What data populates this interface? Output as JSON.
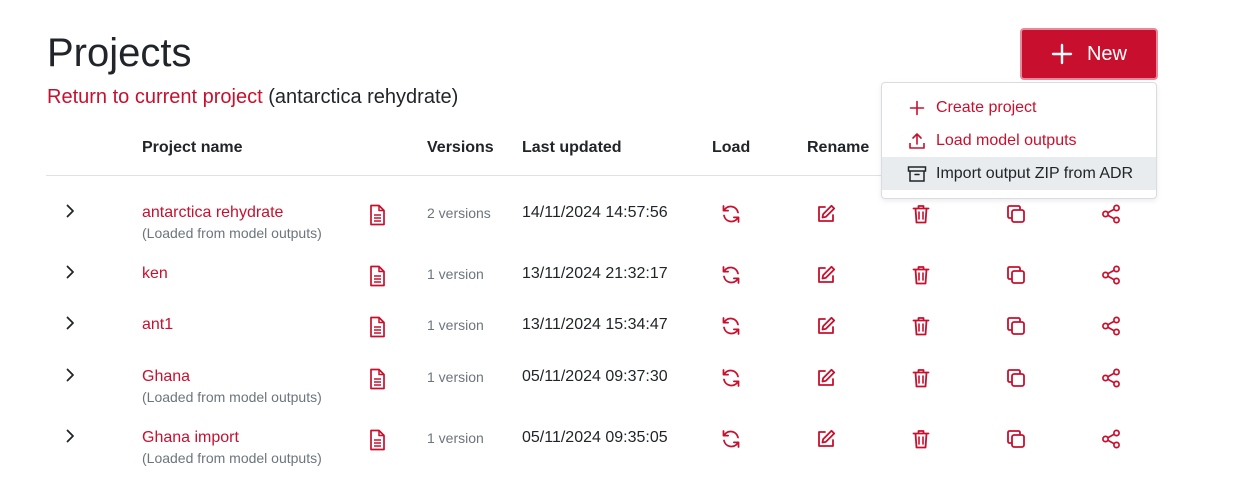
{
  "page": {
    "title": "Projects"
  },
  "return_link": {
    "label": "Return to current project",
    "current": "(antarctica rehydrate)"
  },
  "new_button": {
    "label": "New"
  },
  "new_menu": {
    "items": [
      {
        "label": "Create project",
        "icon": "plus-icon"
      },
      {
        "label": "Load model outputs",
        "icon": "upload-icon"
      },
      {
        "label": "Import output ZIP from ADR",
        "icon": "archive-icon"
      }
    ]
  },
  "table": {
    "headers": {
      "project_name": "Project name",
      "versions": "Versions",
      "last_updated": "Last updated",
      "load": "Load",
      "rename": "Rename"
    },
    "rows": [
      {
        "name": "antarctica rehydrate",
        "note": "(Loaded from model outputs)",
        "versions": "2 versions",
        "updated": "14/11/2024 14:57:56"
      },
      {
        "name": "ken",
        "note": "",
        "versions": "1 version",
        "updated": "13/11/2024 21:32:17"
      },
      {
        "name": "ant1",
        "note": "",
        "versions": "1 version",
        "updated": "13/11/2024 15:34:47"
      },
      {
        "name": "Ghana",
        "note": "(Loaded from model outputs)",
        "versions": "1 version",
        "updated": "05/11/2024 09:37:30"
      },
      {
        "name": "Ghana import",
        "note": "(Loaded from model outputs)",
        "versions": "1 version",
        "updated": "05/11/2024 09:35:05"
      }
    ]
  },
  "colors": {
    "accent": "#c8102e",
    "muted": "#6c757d",
    "text": "#212529",
    "menu_highlight": "#e9ecef"
  }
}
